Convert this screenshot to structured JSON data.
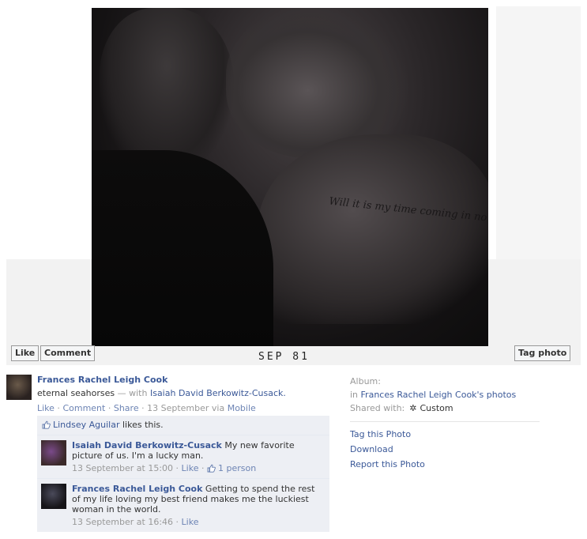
{
  "photo": {
    "tattoo_text": "Will it is my time coming in no",
    "date_stamp": "SEP   81"
  },
  "buttons": {
    "like": "Like",
    "comment": "Comment",
    "tag_photo": "Tag photo"
  },
  "post": {
    "author": "Frances Rachel Leigh Cook",
    "caption": "eternal seahorses",
    "with_prefix": " — with ",
    "tagged": "Isaiah David Berkowitz-Cusack.",
    "actions": {
      "like": "Like",
      "comment": "Comment",
      "share": "Share",
      "sep": " · ",
      "date": "13 September via ",
      "via": "Mobile"
    }
  },
  "likes": {
    "liker": "Lindsey Aguilar",
    "suffix": " likes this."
  },
  "comments": [
    {
      "author": "Isaiah David Berkowitz-Cusack",
      "text": " My new favorite picture of us. I'm a lucky man.",
      "time": "13 September at 15:00",
      "like": "Like",
      "like_count": "1 person"
    },
    {
      "author": "Frances Rachel Leigh Cook",
      "text": " Getting to spend the rest of my life loving my best friend makes me the luckiest woman in the world.",
      "time": "13 September at 16:46",
      "like": "Like"
    }
  ],
  "sidebar": {
    "album_label": "Album:",
    "album_prefix": "in ",
    "album_name": "Frances Rachel Leigh Cook's photos",
    "shared_label": "Shared with:",
    "shared_value": "Custom",
    "tag_this_photo": "Tag this Photo",
    "download": "Download",
    "report": "Report this Photo"
  },
  "colors": {
    "link": "#3b5998",
    "feedback_bg": "#edeff4",
    "muted": "#999999"
  },
  "icons": {
    "thumb": "thumbs-up-icon",
    "gear": "gear-icon"
  }
}
